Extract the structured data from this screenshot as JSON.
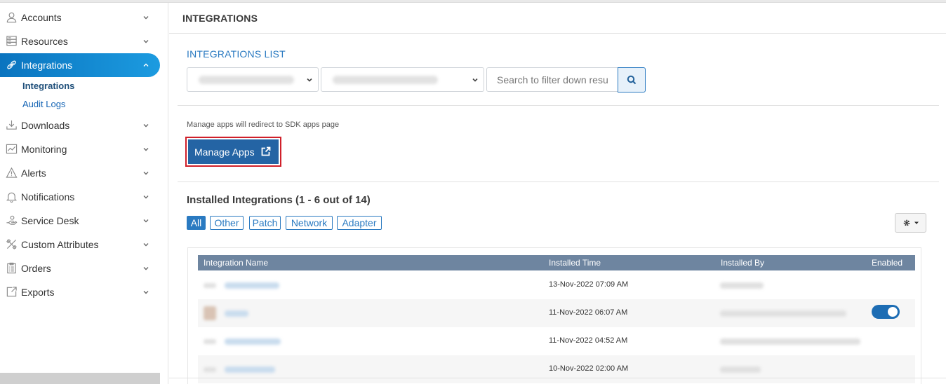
{
  "sidebar": {
    "items": [
      {
        "label": "Accounts",
        "icon": "user-icon"
      },
      {
        "label": "Resources",
        "icon": "server-icon"
      },
      {
        "label": "Integrations",
        "icon": "link-icon",
        "active": true
      },
      {
        "label": "Downloads",
        "icon": "download-icon"
      },
      {
        "label": "Monitoring",
        "icon": "chart-icon"
      },
      {
        "label": "Alerts",
        "icon": "warning-icon"
      },
      {
        "label": "Notifications",
        "icon": "bell-icon"
      },
      {
        "label": "Service Desk",
        "icon": "hand-icon"
      },
      {
        "label": "Custom Attributes",
        "icon": "tools-icon"
      },
      {
        "label": "Orders",
        "icon": "clipboard-icon"
      },
      {
        "label": "Exports",
        "icon": "export-icon"
      }
    ],
    "sub_items": [
      {
        "label": "Integrations"
      },
      {
        "label": "Audit Logs"
      }
    ]
  },
  "page": {
    "title": "INTEGRATIONS",
    "list_title": "INTEGRATIONS  LIST",
    "search_placeholder": "Search to filter down results",
    "redirect_note": "Manage apps will redirect to SDK apps page",
    "manage_label": "Manage Apps",
    "installed_title": "Installed Integrations (1 - 6 out of 14)"
  },
  "filters": [
    "All",
    "Other",
    "Patch",
    "Network",
    "Adapter"
  ],
  "table": {
    "headers": {
      "name": "Integration Name",
      "time": "Installed Time",
      "by": "Installed By",
      "enabled": "Enabled"
    },
    "rows": [
      {
        "time": "13-Nov-2022 07:09 AM",
        "enabled": false
      },
      {
        "time": "11-Nov-2022 06:07 AM",
        "enabled": true
      },
      {
        "time": "11-Nov-2022 04:52 AM",
        "enabled": false
      },
      {
        "time": "10-Nov-2022 02:00 AM",
        "enabled": false
      }
    ]
  },
  "colors": {
    "accent": "#2a7ac1",
    "manage_button": "#2464a4",
    "highlight_border": "#d0202a",
    "table_header": "#6e85a0"
  }
}
